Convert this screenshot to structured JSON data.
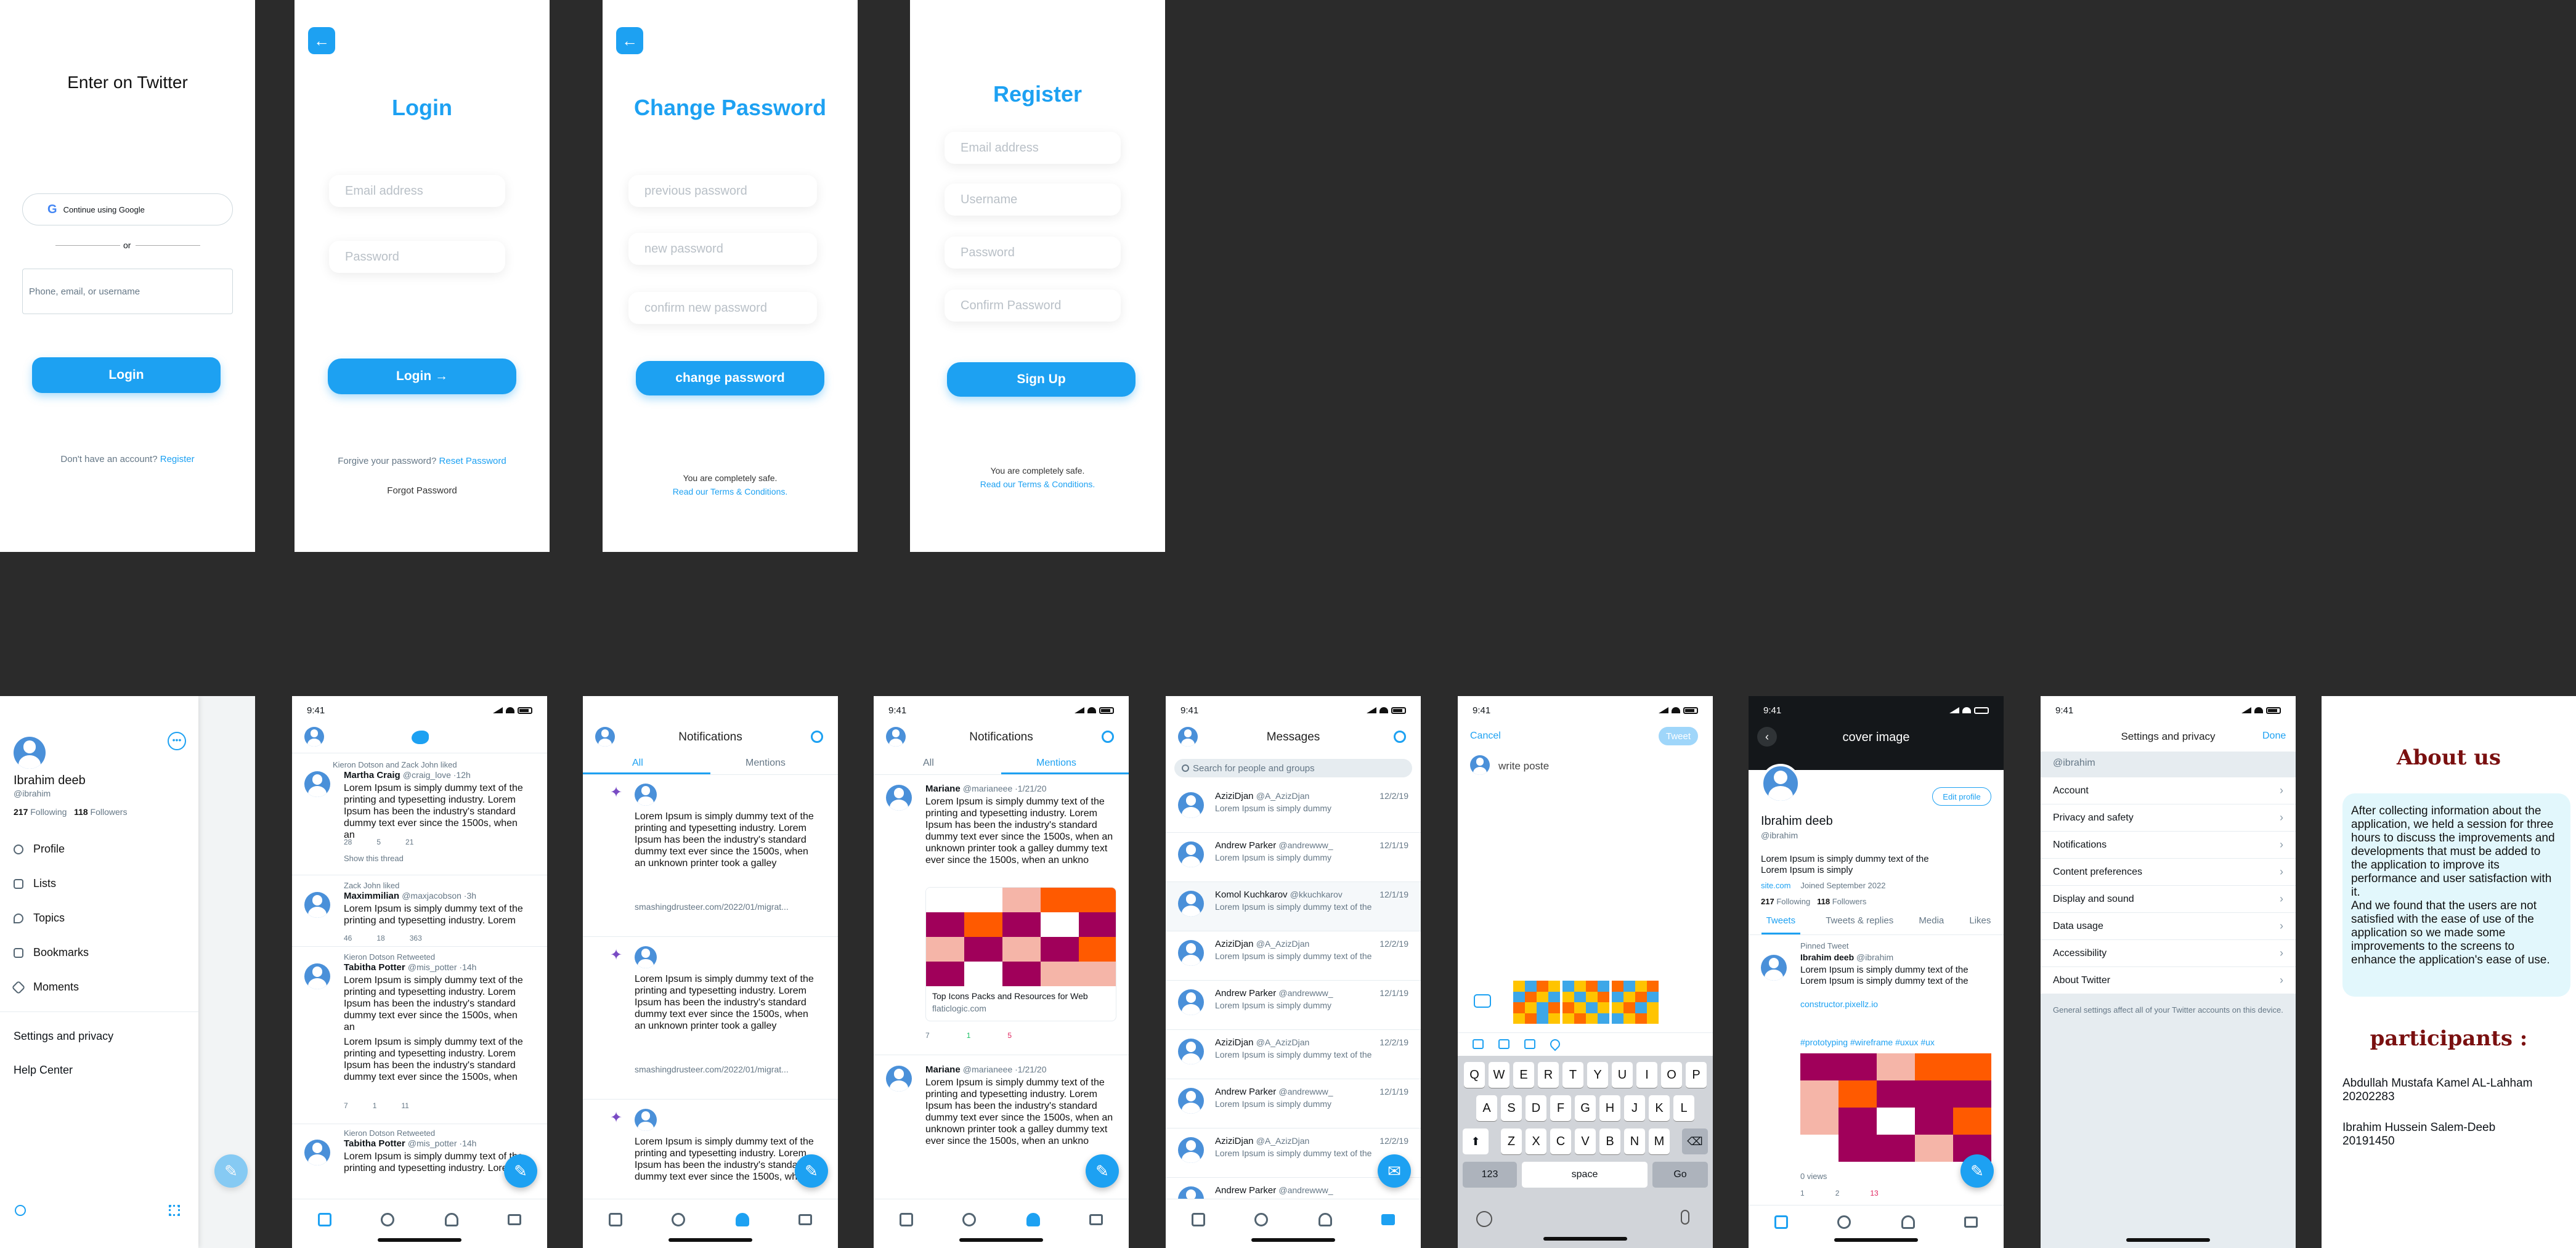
{
  "colors": {
    "accent": "#1da1f2",
    "background": "#2b2b2b",
    "about_title": "#7a1010"
  },
  "enter": {
    "title": "Enter on Twitter",
    "google_label": "Continue using Google",
    "or": "or",
    "phone_placeholder": "Phone, email, or username",
    "login": "Login",
    "no_account": "Don't have an account?",
    "register": "Register"
  },
  "login": {
    "title": "Login",
    "email": "Email address",
    "password": "Password",
    "button": "Login →",
    "forgive": "Forgive your password?",
    "reset": "Reset Password",
    "forgot": "Forgot Password"
  },
  "change": {
    "title": "Change Password",
    "previous": "previous password",
    "new": "new password",
    "confirm": "confirm new password",
    "button": "change password",
    "safe": "You are completely safe.",
    "terms": "Read our Terms & Conditions."
  },
  "register": {
    "title": "Register",
    "email": "Email address",
    "username": "Username",
    "password": "Password",
    "confirm": "Confirm Password",
    "button": "Sign Up",
    "safe": "You are completely safe.",
    "terms": "Read our Terms & Conditions."
  },
  "status_time": "9:41",
  "drawer": {
    "name": "Ibrahim deeb",
    "handle": "@ibrahim",
    "following_count": "217",
    "following": "Following",
    "followers_count": "118",
    "followers": "Followers",
    "items": [
      "Profile",
      "Lists",
      "Topics",
      "Bookmarks",
      "Moments"
    ],
    "settings": "Settings and privacy",
    "help": "Help Center"
  },
  "lorem": "Lorem Ipsum is simply dummy text of the printing and typesetting industry. Lorem Ipsum has been the industry's standard dummy text ever since the 1500s, when an",
  "feed": {
    "t1": {
      "liked": "Kieron Dotson and Zack John liked",
      "name": "Martha Craig",
      "handle": "@craig_love ·12h",
      "c": "28",
      "r": "5",
      "l": "21",
      "thread": "Show this thread"
    },
    "t2": {
      "liked": "Zack John liked",
      "name": "Maximmilian",
      "handle": "@maxjacobson ·3h",
      "c": "46",
      "r": "18",
      "l": "363"
    },
    "t3": {
      "liked": "Kieron Dotson Retweeted",
      "name": "Tabitha Potter",
      "handle": "@mis_potter ·14h",
      "extra": "Lorem Ipsum is simply dummy text of the printing and typesetting industry. Lorem Ipsum has been the industry's standard dummy text ever since the 1500s, when",
      "c": "7",
      "r": "1",
      "l": "11"
    },
    "t4": {
      "liked": "Kieron Dotson Retweeted",
      "name": "Tabitha Potter",
      "handle": "@mis_potter ·14h"
    }
  },
  "notif": {
    "title": "Notifications",
    "tab_all": "All",
    "tab_mentions": "Mentions",
    "text": "Lorem Ipsum is simply dummy text of the printing and typesetting industry. Lorem Ipsum has been the industry's standard dummy text ever since the 1500s, when an unknown printer took a galley",
    "link": "smashingdrusteer.com/2022/01/migrat..."
  },
  "mentions": {
    "name": "Mariane",
    "handle": "@marianeee ·1/21/20",
    "text": "Lorem Ipsum is simply dummy text of the printing and typesetting industry. Lorem Ipsum has been the industry's standard dummy text ever since the 1500s, when an unknown printer took a galley dummy text ever since the 1500s, when an unkno",
    "card_title": "Top Icons Packs and Resources for Web",
    "card_url": "flaticlogic.com",
    "c": "7",
    "r": "1",
    "l": "5"
  },
  "messages": {
    "title": "Messages",
    "search": "Search for people and groups",
    "rows": [
      {
        "name": "AziziDjan",
        "handle": "@A_AzizDjan",
        "date": "12/2/19",
        "text": "Lorem Ipsum is simply dummy"
      },
      {
        "name": "Andrew Parker",
        "handle": "@andrewww_",
        "date": "12/1/19",
        "text": "Lorem Ipsum is simply dummy"
      },
      {
        "name": "Komol Kuchkarov",
        "handle": "@kkuchkarov",
        "date": "12/1/19",
        "text": "Lorem Ipsum is simply dummy text of the"
      },
      {
        "name": "AziziDjan",
        "handle": "@A_AzizDjan",
        "date": "12/2/19",
        "text": "Lorem Ipsum is simply dummy text of the"
      },
      {
        "name": "Andrew Parker",
        "handle": "@andrewww_",
        "date": "12/1/19",
        "text": "Lorem Ipsum is simply dummy"
      },
      {
        "name": "AziziDjan",
        "handle": "@A_AzizDjan",
        "date": "12/2/19",
        "text": "Lorem Ipsum is simply dummy text of the"
      },
      {
        "name": "Andrew Parker",
        "handle": "@andrewww_",
        "date": "12/1/19",
        "text": "Lorem Ipsum is simply dummy"
      },
      {
        "name": "AziziDjan",
        "handle": "@A_AzizDjan",
        "date": "12/2/19",
        "text": "Lorem Ipsum is simply dummy text of the"
      },
      {
        "name": "Andrew Parker",
        "handle": "@andrewww_",
        "date": "",
        "text": ""
      }
    ]
  },
  "compose": {
    "cancel": "Cancel",
    "tweet": "Tweet",
    "placeholder": "write poste",
    "row1": "QWERTYUIOP",
    "row2": "ASDFGHJKL",
    "row3": "ZXCVBNM",
    "num": "123",
    "space": "space",
    "go": "Go"
  },
  "profile": {
    "header": "cover image",
    "edit": "Edit profile",
    "name": "Ibrahim deeb",
    "handle": "@ibrahim",
    "bio": "Lorem Ipsum is simply dummy text of the Lorem Ipsum is simply",
    "link": "site.com",
    "joined": "Joined September 2022",
    "following_count": "217",
    "following": "Following",
    "followers_count": "118",
    "followers": "Followers",
    "tabs": [
      "Tweets",
      "Tweets & replies",
      "Media",
      "Likes"
    ],
    "pinned": "Pinned Tweet",
    "tw_name": "Ibrahim deeb",
    "tw_handle": "@ibrahim",
    "tw_text": "Lorem Ipsum is simply dummy text of the Lorem Ipsum is simply dummy text of the",
    "tw_link": "constructor.pixellz.io",
    "tags": "#prototyping #wireframe #uxux #ux",
    "views": "0 views",
    "c": "1",
    "r": "2",
    "l": "13"
  },
  "settings": {
    "title": "Settings and privacy",
    "done": "Done",
    "handle": "@ibrahim",
    "items": [
      "Account",
      "Privacy and safety",
      "Notifications",
      "Content preferences",
      "Display and sound",
      "Data usage",
      "Accessibility",
      "About Twitter"
    ],
    "note": "General settings affect all of your Twitter accounts on this device."
  },
  "about": {
    "title": "About us",
    "text": "After collecting information about the application, we held a session for three hours to discuss the improvements and developments that must be added to the application to improve its performance and user satisfaction with it.\nAnd we found that the users are not satisfied with the ease of use of the application so we made some improvements to the screens to enhance the application's ease of use.",
    "participants": "participants :",
    "p1_name": "Abdullah Mustafa Kamel AL-Lahham",
    "p1_id": "20202283",
    "p2_name": "Ibrahim Hussein Salem-Deeb",
    "p2_id": "20191450"
  }
}
